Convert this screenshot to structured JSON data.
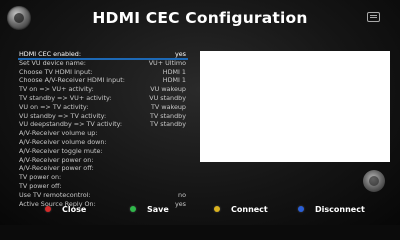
{
  "header": {
    "title": "HDMI CEC Configuration"
  },
  "settings": {
    "rows": [
      {
        "label": "HDMI CEC enabled:",
        "value": "yes"
      },
      {
        "label": "Set VU device name:",
        "value": "VU+ Ultimo"
      },
      {
        "label": "Choose TV HDMI input:",
        "value": "HDMI 1"
      },
      {
        "label": "Choose A/V-Receiver HDMI input:",
        "value": "HDMI 1"
      },
      {
        "label": "TV on => VU+ activity:",
        "value": "VU wakeup"
      },
      {
        "label": "TV standby => VU+ activity:",
        "value": "VU standby"
      },
      {
        "label": "VU on => TV activity:",
        "value": "TV wakeup"
      },
      {
        "label": "VU standby => TV activity:",
        "value": "TV standby"
      },
      {
        "label": "VU deepstandby => TV activity:",
        "value": "TV standby"
      },
      {
        "label": "A/V-Receiver volume up:",
        "value": ""
      },
      {
        "label": "A/V-Receiver volume down:",
        "value": ""
      },
      {
        "label": "A/V-Receiver toggle mute:",
        "value": ""
      },
      {
        "label": "A/V-Receiver power on:",
        "value": ""
      },
      {
        "label": "A/V-Receiver power off:",
        "value": ""
      },
      {
        "label": "TV power on:",
        "value": ""
      },
      {
        "label": "TV power off:",
        "value": ""
      },
      {
        "label": "Use TV remotecontrol:",
        "value": "no"
      },
      {
        "label": "Active Source Reply On:",
        "value": "yes"
      }
    ]
  },
  "footer": {
    "buttons": [
      {
        "label": "Close",
        "color": "#d62a2a"
      },
      {
        "label": "Save",
        "color": "#2fb84a"
      },
      {
        "label": "Connect",
        "color": "#d9b21f"
      },
      {
        "label": "Disconnect",
        "color": "#2a5fd6"
      }
    ]
  }
}
